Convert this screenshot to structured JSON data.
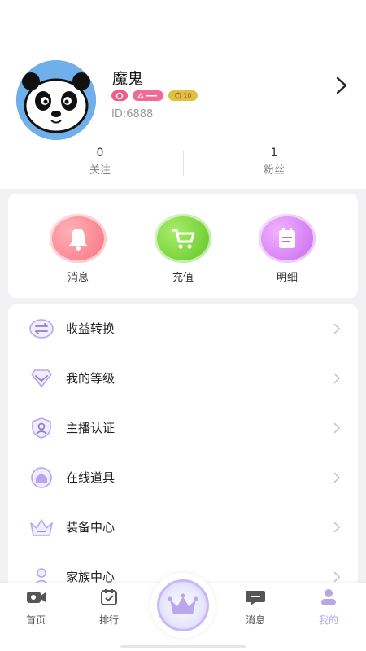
{
  "profile": {
    "name": "魔鬼",
    "id_text": "ID:6888",
    "badge_level": "10"
  },
  "stats": [
    {
      "count": "0",
      "label": "关注"
    },
    {
      "count": "1",
      "label": "粉丝"
    }
  ],
  "quick_actions": [
    {
      "label": "消息",
      "icon": "bell-icon"
    },
    {
      "label": "充值",
      "icon": "cart-icon"
    },
    {
      "label": "明细",
      "icon": "calendar-icon"
    }
  ],
  "menu": [
    {
      "label": "收益转换",
      "icon": "exchange-icon"
    },
    {
      "label": "我的等级",
      "icon": "diamond-icon"
    },
    {
      "label": "主播认证",
      "icon": "verified-user-icon"
    },
    {
      "label": "在线道具",
      "icon": "house-icon"
    },
    {
      "label": "装备中心",
      "icon": "crown-icon"
    },
    {
      "label": "家族中心",
      "icon": "family-icon"
    }
  ],
  "tabbar": [
    {
      "label": "首页",
      "icon": "video-icon"
    },
    {
      "label": "排行",
      "icon": "ranking-icon"
    },
    {
      "label": "消息",
      "icon": "chat-icon"
    },
    {
      "label": "我的",
      "icon": "profile-icon"
    }
  ],
  "colors": {
    "accent_purple": "#b7a6ee",
    "active_tab": "#b6a8e6",
    "bell_pink": "#f76f7b",
    "cart_green": "#6fcf2c",
    "calendar_violet": "#cf6ff0"
  }
}
